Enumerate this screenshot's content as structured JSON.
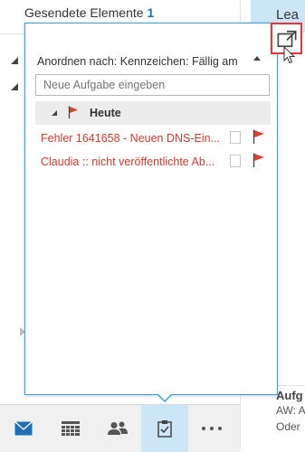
{
  "background": {
    "folder_label": "Gesendete Elemente",
    "folder_count": "1",
    "reading_pane_top": "Lea",
    "reading_pane_partial": "Aufg",
    "reading_pane_line1": "AW: Au",
    "reading_pane_line2": "Oder"
  },
  "peek": {
    "arrange_label": "Anordnen nach: Kennzeichen: Fällig am",
    "new_task_placeholder": "Neue Aufgabe eingeben",
    "group_label": "Heute",
    "tasks": [
      {
        "title": "Fehler 1641658 - Neuen DNS-Ein..."
      },
      {
        "title": "Claudia :: nicht veröffentlichte Ab..."
      }
    ],
    "popout_icon": "popout-icon"
  },
  "nav": {
    "items": [
      {
        "icon": "mail-icon",
        "active": false
      },
      {
        "icon": "calendar-icon",
        "active": false
      },
      {
        "icon": "people-icon",
        "active": false
      },
      {
        "icon": "tasks-icon",
        "active": true
      },
      {
        "icon": "more-icon",
        "active": false
      }
    ]
  },
  "colors": {
    "accent": "#3c9fd9",
    "active_nav": "#cde6f7",
    "task_text": "#d33b32",
    "flag": "#d9412f",
    "highlight_box": "#e8343a"
  }
}
